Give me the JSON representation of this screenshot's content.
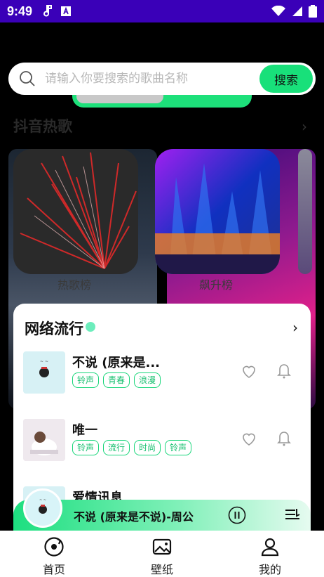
{
  "status_bar": {
    "time": "9:49",
    "left_icons": [
      "music-note-icon",
      "app-a-icon"
    ],
    "right_icons": [
      "wifi-icon",
      "signal-icon",
      "battery-icon"
    ],
    "background": "#3a00b8"
  },
  "search": {
    "placeholder": "请输入你要搜索的歌曲名称",
    "button_label": "搜索"
  },
  "douyin_section": {
    "title": "抖音热歌",
    "cards": [
      {
        "label": "热歌榜"
      },
      {
        "label": "飙升榜"
      }
    ]
  },
  "web_popular": {
    "title": "网络流行",
    "songs": [
      {
        "title": "不说 (原来是...",
        "tags": [
          "铃声",
          "青春",
          "浪漫"
        ]
      },
      {
        "title": "唯一",
        "tags": [
          "铃声",
          "流行",
          "时尚",
          "铃声"
        ]
      },
      {
        "title": "爱情讯息",
        "tags": []
      }
    ]
  },
  "player": {
    "now_playing": "不说 (原来是不说)-周公"
  },
  "tabbar": {
    "tabs": [
      {
        "label": "首页",
        "icon": "music-disc-icon"
      },
      {
        "label": "壁纸",
        "icon": "image-icon"
      },
      {
        "label": "我的",
        "icon": "user-icon"
      }
    ]
  },
  "colors": {
    "accent": "#1de07a",
    "tag": "#18d67a"
  }
}
